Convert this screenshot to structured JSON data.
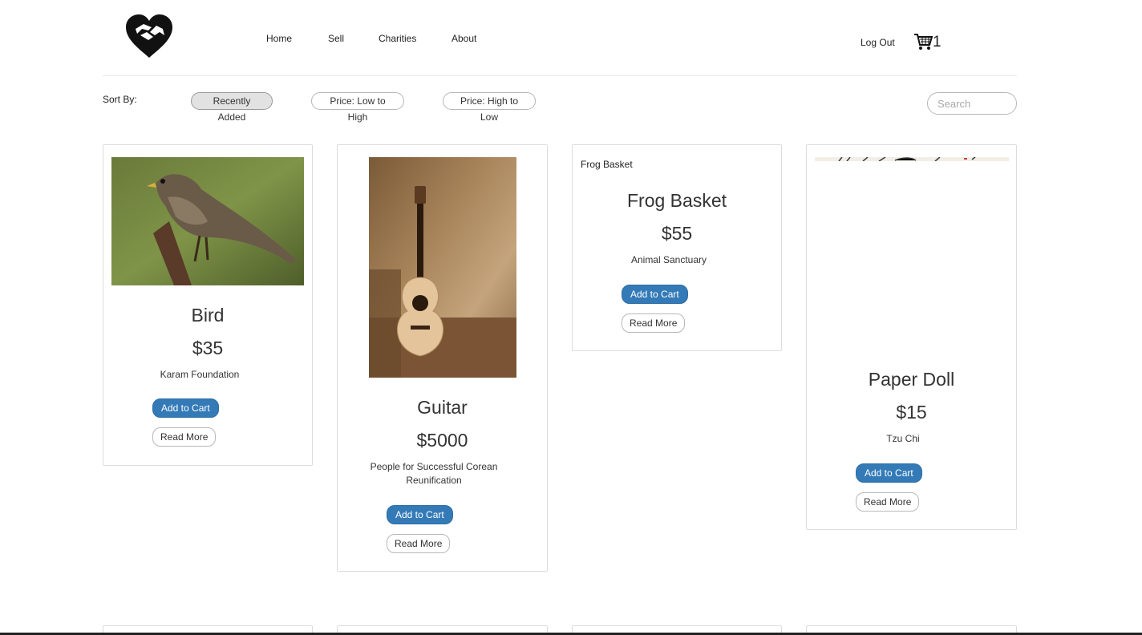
{
  "header": {
    "nav": [
      {
        "label": "Home"
      },
      {
        "label": "Sell"
      },
      {
        "label": "Charities"
      },
      {
        "label": "About"
      }
    ],
    "logout_label": "Log Out",
    "cart_count": "1",
    "cart_icon": "shopping-cart-icon",
    "logo_icon": "heart-hands-logo"
  },
  "sort": {
    "label": "Sort By:",
    "options": [
      {
        "label": "Recently Added",
        "active": true
      },
      {
        "label": "Price: Low to High",
        "active": false
      },
      {
        "label": "Price: High to Low",
        "active": false
      }
    ]
  },
  "search": {
    "placeholder": "Search",
    "value": ""
  },
  "products": [
    {
      "title": "Bird",
      "price": "$35",
      "charity": "Karam Foundation",
      "add_label": "Add to Cart",
      "more_label": "Read More",
      "image": "bird-photo"
    },
    {
      "title": "Guitar",
      "price": "$5000",
      "charity": "People for Successful Corean Reunification",
      "add_label": "Add to Cart",
      "more_label": "Read More",
      "image": "guitar-photo"
    },
    {
      "title": "Frog Basket",
      "alt_text": "Frog Basket",
      "price": "$55",
      "charity": "Animal Sanctuary",
      "add_label": "Add to Cart",
      "more_label": "Read More",
      "image": "broken-image"
    },
    {
      "title": "Paper Doll",
      "price": "$15",
      "charity": "Tzu Chi",
      "add_label": "Add to Cart",
      "more_label": "Read More",
      "image": "paper-doll-photo"
    }
  ],
  "colors": {
    "primary": "#337ab7",
    "border": "#dcdcdc",
    "text": "#333333"
  }
}
